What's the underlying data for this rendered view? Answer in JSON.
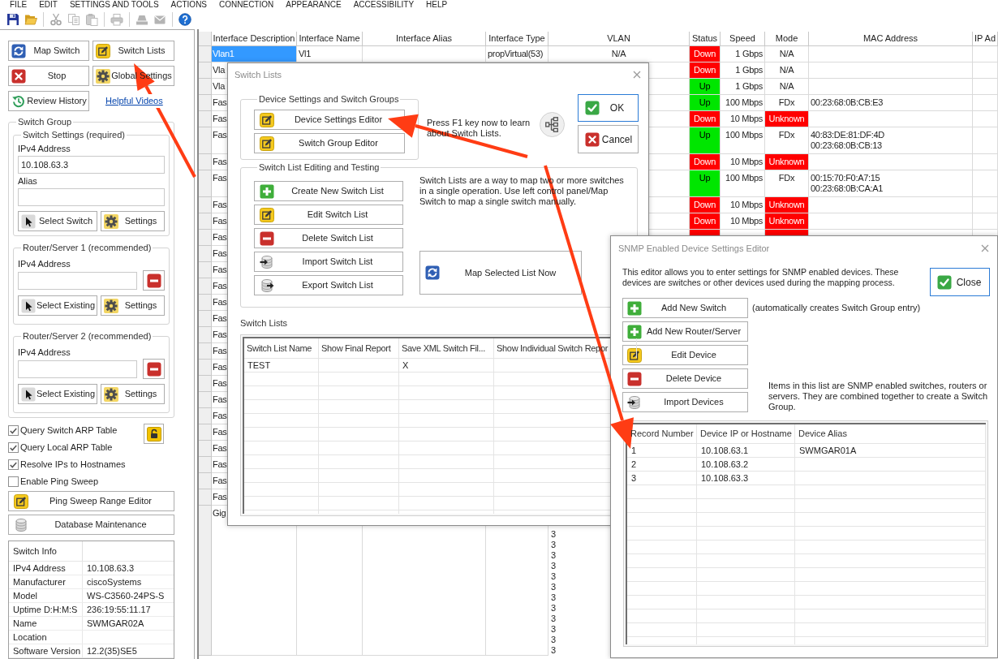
{
  "menu": [
    "FILE",
    "EDIT",
    "SETTINGS AND TOOLS",
    "ACTIONS",
    "CONNECTION",
    "APPEARANCE",
    "ACCESSIBILITY",
    "HELP"
  ],
  "toolbar": [
    {
      "kind": "save",
      "disabled": false
    },
    {
      "kind": "open",
      "disabled": false
    },
    {
      "kind": "separator"
    },
    {
      "kind": "cut",
      "disabled": true
    },
    {
      "kind": "copy",
      "disabled": true
    },
    {
      "kind": "paste",
      "disabled": true
    },
    {
      "kind": "separator"
    },
    {
      "kind": "print",
      "disabled": true
    },
    {
      "kind": "separator"
    },
    {
      "kind": "tray",
      "disabled": true
    },
    {
      "kind": "mail",
      "disabled": true
    },
    {
      "kind": "separator"
    },
    {
      "kind": "help",
      "disabled": false
    }
  ],
  "left_panel": {
    "buttons": [
      {
        "kind": "sync",
        "label": "Map Switch"
      },
      {
        "kind": "edit",
        "label": "Switch Lists"
      },
      {
        "kind": "stop",
        "label": "Stop"
      },
      {
        "kind": "gear",
        "label": "Global Settings"
      },
      {
        "kind": "history",
        "label": "Review History"
      }
    ],
    "link": "Helpful Videos",
    "switch_group": {
      "title": "Switch Group",
      "switch_settings": {
        "title": "Switch Settings (required)",
        "ip_label": "IPv4 Address",
        "ip_value": "10.108.63.3",
        "alias_label": "Alias",
        "buttons": [
          {
            "kind": "pointer",
            "label": "Select Switch"
          },
          {
            "kind": "gear",
            "label": "Settings"
          }
        ]
      },
      "routers": [
        {
          "title": "Router/Server 1 (recommended)",
          "ip_label": "IPv4 Address",
          "buttons": [
            {
              "kind": "pointer",
              "label": "Select Existing"
            },
            {
              "kind": "gear",
              "label": "Settings"
            }
          ]
        },
        {
          "title": "Router/Server 2 (recommended)",
          "ip_label": "IPv4 Address",
          "buttons": [
            {
              "kind": "pointer",
              "label": "Select Existing"
            },
            {
              "kind": "gear",
              "label": "Settings"
            }
          ]
        }
      ]
    },
    "options": [
      {
        "label": "Query Switch ARP Table",
        "checked": true
      },
      {
        "label": "Query Local ARP Table",
        "checked": true
      },
      {
        "label": "Resolve IPs to Hostnames",
        "checked": true
      },
      {
        "label": "Enable Ping Sweep",
        "checked": false
      }
    ],
    "tool_buttons": [
      {
        "kind": "edit",
        "label": "Ping Sweep Range Editor"
      },
      {
        "kind": "database",
        "label": "Database Maintenance"
      }
    ],
    "switch_info": {
      "title": "Switch Info",
      "rows": [
        {
          "label": "IPv4 Address",
          "value": "10.108.63.3"
        },
        {
          "label": "Manufacturer",
          "value": "ciscoSystems"
        },
        {
          "label": "Model",
          "value": "WS-C3560-24PS-S"
        },
        {
          "label": "Uptime D:H:M:S",
          "value": "236:19:55:11.17"
        },
        {
          "label": "Name",
          "value": "SWMGAR02A"
        },
        {
          "label": "Location"
        },
        {
          "label": "Software Version",
          "value": "12.2(35)SE5"
        }
      ]
    }
  },
  "table": {
    "columns": [
      "Interface Description",
      "Interface Name",
      "Interface Alias",
      "Interface Type",
      "VLAN",
      "Status",
      "Speed",
      "Mode",
      "MAC Address",
      "IP Ad"
    ],
    "rows": [
      {
        "selected": true,
        "description": "Vlan1",
        "name": "Vl1",
        "type": "propVirtual(53)",
        "vlan": "N/A",
        "status": "Down",
        "status_up": false,
        "speed": "1 Gbps",
        "mode": "N/A",
        "mode_warning": false
      },
      {
        "selected": false,
        "description": "Vla",
        "status": "Down",
        "status_up": false,
        "speed": "1 Gbps",
        "mode": "N/A",
        "mode_warning": false
      },
      {
        "selected": false,
        "description": "Vla",
        "status": "Up",
        "status_up": true,
        "speed": "1 Gbps",
        "mode": "N/A",
        "mode_warning": false
      },
      {
        "selected": false,
        "description": "Fas",
        "status": "Up",
        "status_up": true,
        "speed": "100 Mbps",
        "mode": "FDx",
        "mode_warning": false,
        "mac": [
          "00:23:68:0B:CB:E3"
        ]
      },
      {
        "selected": false,
        "description": "Fas",
        "status": "Down",
        "status_up": false,
        "speed": "10 Mbps",
        "mode": "Unknown",
        "mode_warning": true
      },
      {
        "selected": false,
        "description": "Fas",
        "status": "Up",
        "status_up": true,
        "speed": "100 Mbps",
        "mode": "FDx",
        "mode_warning": false,
        "mac": [
          "40:83:DE:81:DF:4D",
          "00:23:68:0B:CB:13"
        ]
      },
      {
        "selected": false,
        "description": "Fas",
        "status": "Down",
        "status_up": false,
        "speed": "10 Mbps",
        "mode": "Unknown",
        "mode_warning": true
      },
      {
        "selected": false,
        "description": "Fas",
        "status": "Up",
        "status_up": true,
        "speed": "100 Mbps",
        "mode": "FDx",
        "mode_warning": false,
        "mac": [
          "00:15:70:F0:A7:15",
          "00:23:68:0B:CA:A1"
        ]
      },
      {
        "selected": false,
        "description": "Fas",
        "status": "Down",
        "status_up": false,
        "speed": "10 Mbps",
        "mode": "Unknown",
        "mode_warning": true
      },
      {
        "selected": false,
        "description": "Fas",
        "status": "Down",
        "status_up": false,
        "speed": "10 Mbps",
        "mode": "Unknown",
        "mode_warning": true
      },
      {
        "selected": false,
        "description": "Fas",
        "status_up": false,
        "mode_warning": true
      },
      {
        "selected": false,
        "description": "Fas"
      },
      {
        "selected": false,
        "description": "Fas"
      },
      {
        "selected": false,
        "description": "Fas"
      },
      {
        "selected": false,
        "description": "Fas"
      },
      {
        "selected": false,
        "description": "Fas"
      },
      {
        "selected": false,
        "description": "Fas"
      },
      {
        "selected": false,
        "description": "Fas"
      },
      {
        "selected": false,
        "description": "Fas"
      },
      {
        "selected": false,
        "description": "Fas"
      },
      {
        "selected": false,
        "description": "Fas"
      },
      {
        "selected": false,
        "description": "Fas"
      },
      {
        "selected": false,
        "description": "Fas"
      },
      {
        "selected": false,
        "description": "Fas"
      },
      {
        "selected": false,
        "description": "Fas"
      },
      {
        "selected": false,
        "description": "Fas"
      },
      {
        "selected": false,
        "description": "Fas"
      },
      {
        "selected": false,
        "description": "Gig",
        "vlan_lines": [
          "3",
          "3",
          "3",
          "3",
          "3",
          "3",
          "3",
          "3",
          "3",
          "3",
          "3",
          "3"
        ]
      }
    ]
  },
  "switch_lists_dialog": {
    "title": "Switch Lists",
    "device_group": {
      "title": "Device Settings and Switch Groups",
      "buttons": [
        {
          "kind": "edit",
          "label": "Device Settings Editor"
        },
        {
          "kind": "edit",
          "label": "Switch Group Editor"
        }
      ]
    },
    "help_text": "Press F1 key now to learn about Switch Lists.",
    "ok_button": "OK",
    "cancel_button": "Cancel",
    "editing_group": {
      "title": "Switch List Editing and Testing",
      "buttons": [
        {
          "kind": "add",
          "label": "Create New Switch List"
        },
        {
          "kind": "edit",
          "label": "Edit Switch List"
        },
        {
          "kind": "delete",
          "label": "Delete Switch List"
        },
        {
          "kind": "import",
          "label": "Import Switch List"
        },
        {
          "kind": "export",
          "label": "Export Switch List"
        }
      ],
      "description": "Switch Lists are a way to map two or more switches in a single operation. Use left control panel/Map Switch to map a single switch manually.",
      "map_button": "Map Selected List Now"
    },
    "lists_label": "Switch Lists",
    "grid": {
      "columns": [
        "Switch List Name",
        "Show Final Report",
        "Save XML Switch Fil...",
        "Show Individual Switch Repor"
      ],
      "rows": [
        [
          "TEST",
          null,
          "X",
          null
        ]
      ]
    }
  },
  "snmp_dialog": {
    "title": "SNMP Enabled Device Settings Editor",
    "intro": "This editor allows you to enter settings for SNMP enabled devices. These devices are switches or other devices used during the mapping process.",
    "close_button": "Close",
    "buttons": [
      {
        "kind": "add",
        "label": "Add New Switch"
      },
      {
        "kind": "add",
        "label": "Add New Router/Server"
      },
      {
        "kind": "edit",
        "label": "Edit Device"
      },
      {
        "kind": "delete",
        "label": "Delete Device"
      },
      {
        "kind": "import",
        "label": "Import Devices"
      }
    ],
    "add_switch_note": "(automatically creates Switch Group entry)",
    "list_note": "Items in this list are SNMP enabled switches, routers or servers. They are combined together to create a Switch Group.",
    "grid": {
      "columns": [
        "Record Number",
        "Device IP or Hostname",
        "Device Alias"
      ],
      "rows": [
        [
          "1",
          "10.108.63.1",
          "SWMGAR01A"
        ],
        [
          "2",
          "10.108.63.2",
          null
        ],
        [
          "3",
          "10.108.63.3",
          null
        ]
      ]
    }
  }
}
